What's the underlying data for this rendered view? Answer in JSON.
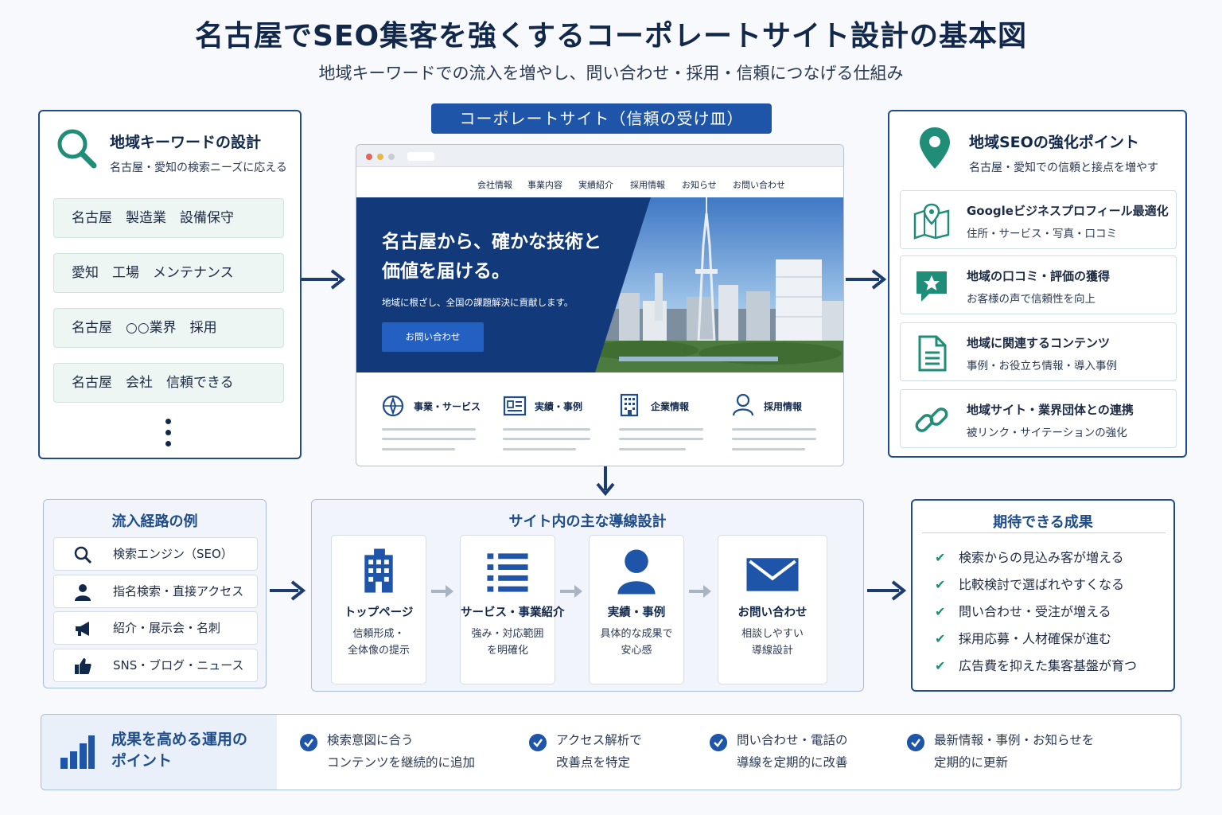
{
  "header": {
    "title": "名古屋でSEO集客を強くするコーポレートサイト設計の基本図",
    "subtitle": "地域キーワードでの流入を増やし、問い合わせ・採用・信頼につなげる仕組み"
  },
  "keyword_panel": {
    "icon": "search-icon",
    "title": "地域キーワードの設計",
    "subtitle": "名古屋・愛知の検索ニーズに応える",
    "items": [
      "名古屋　製造業　設備保守",
      "愛知　工場　メンテナンス",
      "名古屋　○○業界　採用",
      "名古屋　会社　信頼できる"
    ]
  },
  "site": {
    "label": "コーポレートサイト（信頼の受け皿）",
    "nav": [
      "会社情報",
      "事業内容",
      "実績紹介",
      "採用情報",
      "お知らせ",
      "お問い合わせ"
    ],
    "hero_title_line1": "名古屋から、確かな技術と",
    "hero_title_line2": "価値を届ける。",
    "hero_subtitle": "地域に根ざし、全国の課題解決に貢献します。",
    "hero_button": "お問い合わせ",
    "features": [
      {
        "icon": "compass-icon",
        "label": "事業・サービス"
      },
      {
        "icon": "id-card-icon",
        "label": "実績・事例"
      },
      {
        "icon": "building-icon",
        "label": "企業情報"
      },
      {
        "icon": "person-icon",
        "label": "採用情報"
      }
    ]
  },
  "seo_panel": {
    "icon": "map-pin-icon",
    "title": "地域SEOの強化ポイント",
    "subtitle": "名古屋・愛知での信頼と接点を増やす",
    "items": [
      {
        "icon": "map-icon",
        "title": "Googleビジネスプロフィール最適化",
        "sub": "住所・サービス・写真・口コミ"
      },
      {
        "icon": "star-bubble-icon",
        "title": "地域の口コミ・評価の獲得",
        "sub": "お客様の声で信頼性を向上"
      },
      {
        "icon": "document-icon",
        "title": "地域に関連するコンテンツ",
        "sub": "事例・お役立ち情報・導入事例"
      },
      {
        "icon": "link-icon",
        "title": "地域サイト・業界団体との連携",
        "sub": "被リンク・サイテーションの強化"
      }
    ]
  },
  "routes": {
    "title": "流入経路の例",
    "items": [
      {
        "icon": "search-icon",
        "label": "検索エンジン（SEO）"
      },
      {
        "icon": "person-icon",
        "label": "指名検索・直接アクセス"
      },
      {
        "icon": "megaphone-icon",
        "label": "紹介・展示会・名刺"
      },
      {
        "icon": "thumbs-up-icon",
        "label": "SNS・ブログ・ニュース"
      }
    ]
  },
  "flow": {
    "title": "サイト内の主な導線設計",
    "steps": [
      {
        "icon": "building-icon",
        "title": "トップページ",
        "desc1": "信頼形成・",
        "desc2": "全体像の提示"
      },
      {
        "icon": "list-icon",
        "title": "サービス・事業紹介",
        "desc1": "強み・対応範囲",
        "desc2": "を明確化"
      },
      {
        "icon": "person-icon",
        "title": "実績・事例",
        "desc1": "具体的な成果で",
        "desc2": "安心感"
      },
      {
        "icon": "mail-icon",
        "title": "お問い合わせ",
        "desc1": "相談しやすい",
        "desc2": "導線設計"
      }
    ]
  },
  "results": {
    "title": "期待できる成果",
    "items": [
      "検索からの見込み客が増える",
      "比較検討で選ばれやすくなる",
      "問い合わせ・受注が増える",
      "採用応募・人材確保が進む",
      "広告費を抑えた集客基盤が育つ"
    ]
  },
  "operations": {
    "title_line1": "成果を高める運用の",
    "title_line2": "ポイント",
    "items": [
      {
        "line1": "検索意図に合う",
        "line2": "コンテンツを継続的に追加"
      },
      {
        "line1": "アクセス解析で",
        "line2": "改善点を特定"
      },
      {
        "line1": "問い合わせ・電話の",
        "line2": "導線を定期的に改善"
      },
      {
        "line1": "最新情報・事例・お知らせを",
        "line2": "定期的に更新"
      }
    ]
  },
  "colors": {
    "primary": "#1f55a8",
    "navy": "#12284b",
    "teal": "#1f8d78",
    "arrow": "#1c3d6e",
    "arrow_light": "#a9b4c2"
  }
}
